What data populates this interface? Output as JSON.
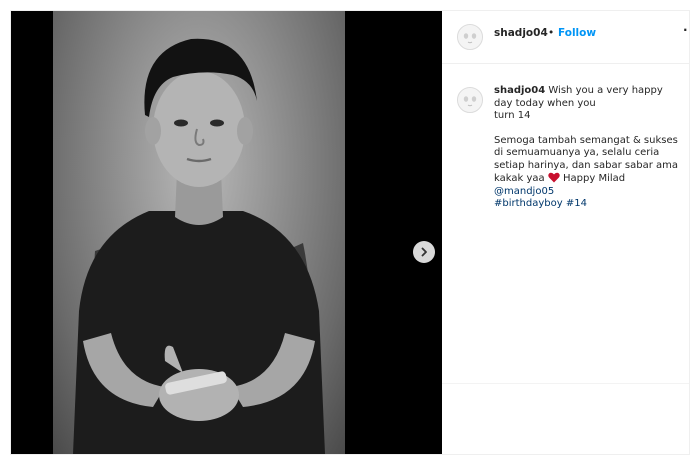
{
  "post": {
    "username": "shadjo04",
    "dot": "•",
    "follow_label": "Follow",
    "more_label": "·",
    "caption": {
      "username": "shadjo04",
      "line1": "Wish you a very happy day today when you",
      "line2": "turn 14",
      "line3": "Semoga tambah semangat & sukses di semuamuanya ya, selalu ceria setiap harinya, dan sabar sabar ama kakak yaa",
      "line3_end": "Happy Milad",
      "mention": "@mandjo05",
      "hashtags": [
        "#birthdayboy",
        "#14"
      ]
    }
  },
  "icons": {
    "next": "chevron-right-icon",
    "heart": "red-heart-icon",
    "avatar": "avatar-face-icon"
  },
  "colors": {
    "follow": "#0095f6",
    "link": "#00376b",
    "heart": "#ed4956"
  }
}
